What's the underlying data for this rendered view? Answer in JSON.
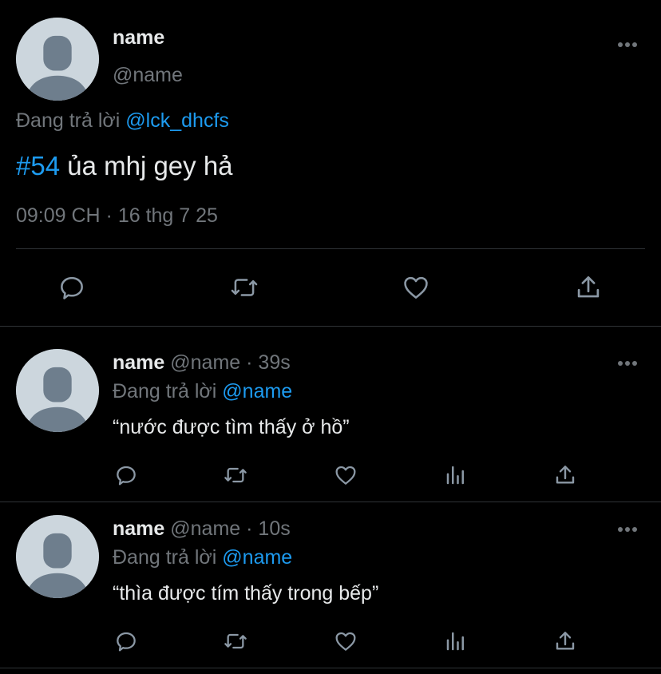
{
  "main_tweet": {
    "display_name": "name",
    "handle": "@name",
    "reply_prefix": "Đang trả lời",
    "reply_to": "@lck_dhcfs",
    "hashtag": "#54",
    "text": " ủa mhj gey hả",
    "timestamp": "09:09 CH · 16 thg 7 25"
  },
  "replies": [
    {
      "display_name": "name",
      "handle": "@name",
      "sep": "·",
      "time": "39s",
      "reply_prefix": "Đang trả lời",
      "reply_to": "@name",
      "text": "“nước được tìm thấy ở hồ”"
    },
    {
      "display_name": "name",
      "handle": "@name",
      "sep": "·",
      "time": "10s",
      "reply_prefix": "Đang trả lời",
      "reply_to": "@name",
      "text": "“thìa được tím thấy trong bếp”"
    }
  ],
  "icons": {
    "reply": "reply-icon",
    "retweet": "retweet-icon",
    "like": "heart-icon",
    "views": "analytics-icon",
    "share": "share-icon",
    "more": "more-icon"
  },
  "colors": {
    "background": "#000000",
    "text": "#e7e9ea",
    "muted": "#71767b",
    "link": "#1d9bf0",
    "divider": "#2f3336",
    "avatar_bg": "#ccd6dd",
    "avatar_fg": "#6e7e8d"
  }
}
